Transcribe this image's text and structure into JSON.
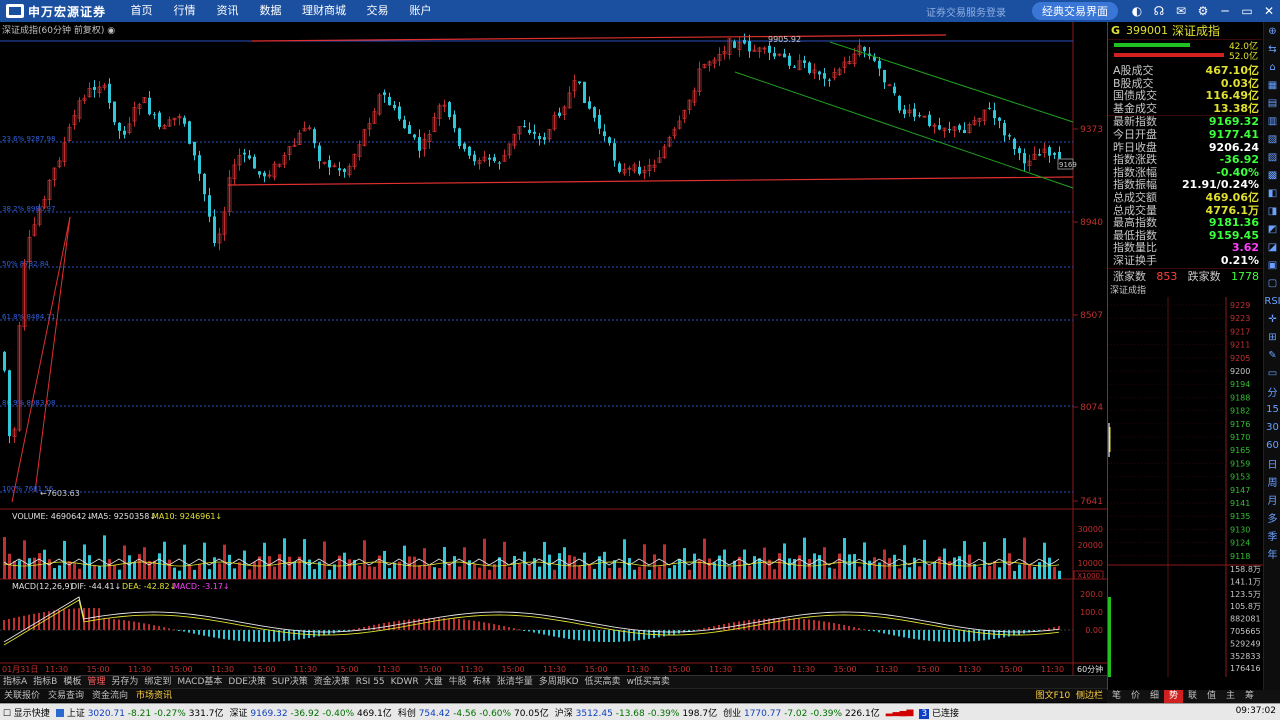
{
  "app": {
    "logo_text": "申万宏源证券",
    "nav": [
      "首页",
      "行情",
      "资讯",
      "数据",
      "理财商城",
      "交易",
      "账户"
    ],
    "login_hint": "证券交易服务登录",
    "classic_button": "经典交易界面"
  },
  "chart": {
    "title": "深证成指(60分钟 前复权)",
    "price_labels": [
      "9373",
      "8940",
      "8507",
      "8074",
      "7641"
    ],
    "fib_labels": [
      "23.6% 9287.98",
      "38.2% 8980.97",
      "50% 8732.84",
      "61.8% 8484.71",
      "80.9% 8083.08",
      "100% 7681.56"
    ],
    "high_label": "9905.92",
    "low_label": "7603.63",
    "last_label": "9169",
    "time_labels": [
      "01月31日",
      "11:30",
      "15:00",
      "11:30",
      "15:00",
      "11:30",
      "15:00",
      "11:30",
      "15:00",
      "11:30",
      "15:00",
      "11:30",
      "15:00",
      "11:30",
      "15:00",
      "11:30",
      "15:00",
      "11:30",
      "15:00",
      "11:30",
      "15:00",
      "11:30",
      "15:00",
      "11:30",
      "15:00",
      "11:30",
      "15:00"
    ],
    "period_label": "60分钟",
    "volume_header": {
      "label": "VOLUME: 4690642",
      "ma5": "MA5: 9250358",
      "ma10": "MA10: 9246961"
    },
    "volume_ticks": [
      "30000",
      "20000",
      "10000",
      "X1000"
    ],
    "macd_header": {
      "label": "MACD(12,26,9)",
      "dif": "DIF: -44.41",
      "dea": "DEA: -42.82",
      "macd": "MACD: -3.17"
    },
    "macd_ticks": [
      "200.0",
      "100.0",
      "0.00"
    ]
  },
  "panel": {
    "marker": "G",
    "code": "399001",
    "name": "深证成指",
    "ratio_top": "42.0亿",
    "ratio_bottom": "52.0亿",
    "rows1": [
      {
        "k": "A股成交",
        "v": "467.10亿",
        "c": "yel"
      },
      {
        "k": "B股成交",
        "v": "0.03亿",
        "c": "yel"
      },
      {
        "k": "国债成交",
        "v": "116.49亿",
        "c": "yel"
      },
      {
        "k": "基金成交",
        "v": "13.38亿",
        "c": "yel"
      }
    ],
    "rows2": [
      {
        "k": "最新指数",
        "v": "9169.32",
        "c": "down"
      },
      {
        "k": "今日开盘",
        "v": "9177.41",
        "c": "down"
      },
      {
        "k": "昨日收盘",
        "v": "9206.24",
        "c": "white"
      },
      {
        "k": "指数涨跌",
        "v": "-36.92",
        "c": "down"
      },
      {
        "k": "指数涨幅",
        "v": "-0.40%",
        "c": "down"
      },
      {
        "k": "指数振幅",
        "v": "21.91/0.24%",
        "c": "white"
      },
      {
        "k": "总成交额",
        "v": "469.06亿",
        "c": "yel"
      },
      {
        "k": "总成交量",
        "v": "4776.1万",
        "c": "yel"
      },
      {
        "k": "最高指数",
        "v": "9181.36",
        "c": "down"
      },
      {
        "k": "最低指数",
        "v": "9159.45",
        "c": "down"
      },
      {
        "k": "指数量比",
        "v": "3.62",
        "c": "mag"
      },
      {
        "k": "深证换手",
        "v": "0.21%",
        "c": "white"
      }
    ],
    "breadth": {
      "up_label": "涨家数",
      "up": "853",
      "down_label": "跌家数",
      "down": "1778"
    },
    "mini_title": "深证成指",
    "mini_prices": [
      "9229",
      "9223",
      "9217",
      "9211",
      "9205",
      "9200",
      "9194",
      "9188",
      "9182",
      "9176",
      "9170",
      "9165",
      "9159",
      "9153",
      "9147",
      "9141",
      "9135",
      "9130",
      "9124",
      "9118"
    ],
    "mini_vols": [
      "158.8万",
      "141.1万",
      "123.5万",
      "105.8万",
      "882081",
      "705665",
      "529249",
      "352833",
      "176416"
    ],
    "tabs": [
      "笔",
      "价",
      "细",
      "势",
      "联",
      "值",
      "主",
      "筹"
    ],
    "active_tab": 3
  },
  "right_tools": [
    "⊕",
    "⇆",
    "⌂",
    "▦",
    "▤",
    "▥",
    "▧",
    "▨",
    "▩",
    "◧",
    "◨",
    "◩",
    "◪",
    "▣",
    "▢",
    "RSI",
    "✛",
    "⊞",
    "✎",
    "▭",
    "分",
    "15",
    "30",
    "60",
    "日",
    "周",
    "月",
    "多",
    "季",
    "年"
  ],
  "indicator_tabs": [
    "指标A",
    "指标B",
    "模板",
    "管理",
    "另存为",
    "绑定到",
    "MACD基本",
    "DDE决策",
    "SUP决策",
    "资金决策",
    "RSI 55",
    "KDWR",
    "大盘",
    "牛股",
    "布林",
    "张清华量",
    "多周期KD",
    "低买高卖",
    "w低买高卖"
  ],
  "active_indicator": 3,
  "news_bar": {
    "items": [
      "关联报价",
      "交易查询",
      "资金流向",
      "市场资讯"
    ],
    "f10": "图文F10",
    "side": "侧边栏"
  },
  "status": {
    "show_quick": "显示快捷",
    "sh": {
      "name": "上证",
      "price": "3020.71",
      "chg": "-8.21",
      "pct": "-0.27%",
      "amt": "331.7亿"
    },
    "sz": {
      "name": "深证",
      "price": "9169.32",
      "chg": "-36.92",
      "pct": "-0.40%",
      "amt": "469.1亿"
    },
    "kc": {
      "name": "科创",
      "price": "754.42",
      "chg": "-4.56",
      "pct": "-0.60%",
      "amt": "70.05亿"
    },
    "hs": {
      "name": "沪深",
      "price": "3512.45",
      "chg": "-13.68",
      "pct": "-0.39%",
      "amt": "198.7亿"
    },
    "cy": {
      "name": "创业",
      "price": "1770.77",
      "chg": "-7.02",
      "pct": "-0.39%",
      "amt": "226.1亿"
    },
    "conn_num": "3",
    "conn": "已连接",
    "clock": "09:37:02"
  },
  "colors": {
    "up": "#ff4040",
    "down": "#3cff3c",
    "candle_up": "#c03030",
    "candle_down": "#30c8d8",
    "fib_line": "#2a4fc0",
    "trend_red": "#e03030",
    "trend_green": "#20a020"
  }
}
